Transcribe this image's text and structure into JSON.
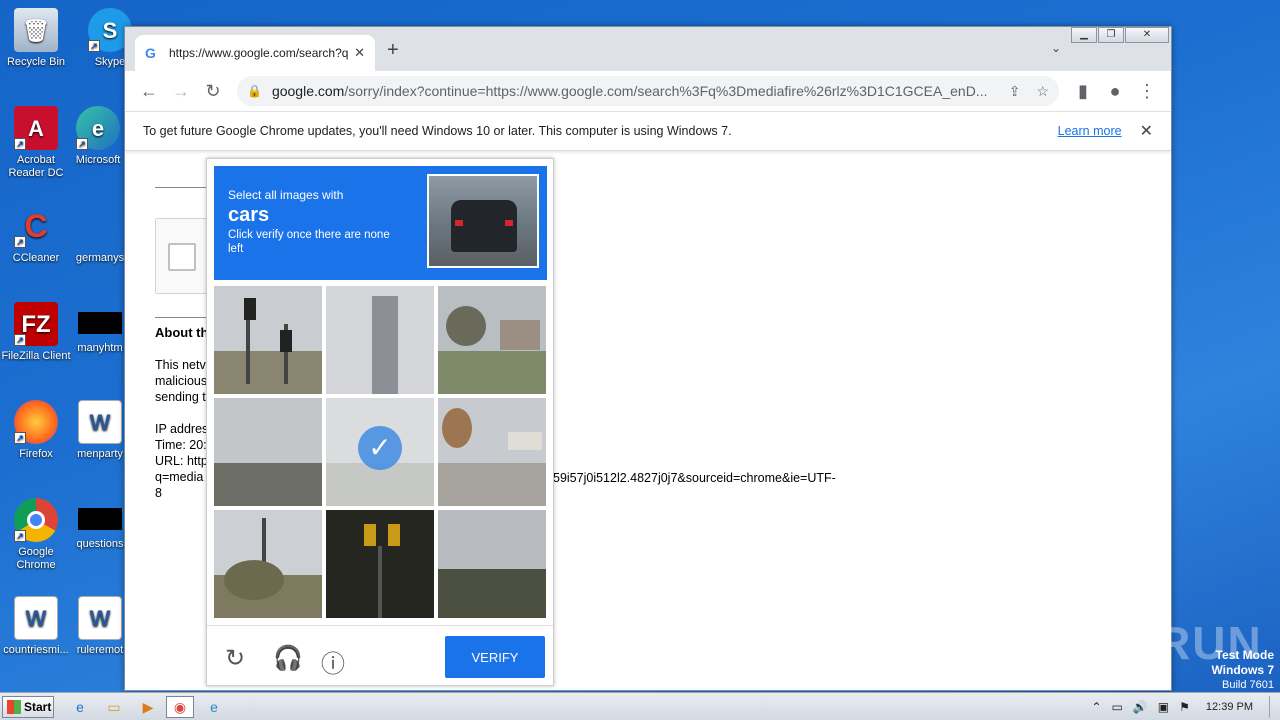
{
  "desktop": {
    "icons": [
      {
        "label": "Recycle Bin"
      },
      {
        "label": "Skype"
      },
      {
        "label": "Acrobat Reader DC"
      },
      {
        "label": "Microsoft"
      },
      {
        "label": "CCleaner"
      },
      {
        "label": "germanys"
      },
      {
        "label": "FileZilla Client"
      },
      {
        "label": "manyhtm"
      },
      {
        "label": "Firefox"
      },
      {
        "label": "menparty"
      },
      {
        "label": "Google Chrome"
      },
      {
        "label": "questions"
      },
      {
        "label": "countriesmi..."
      },
      {
        "label": "ruleremot"
      }
    ]
  },
  "browser": {
    "tab_title": "https://www.google.com/search?q=",
    "url_host": "google.com",
    "url_path": "/sorry/index?continue=https://www.google.com/search%3Fq%3Dmediafire%26rlz%3D1C1GCEA_enD...",
    "infobar_text": "To get future Google Chrome updates, you'll need Windows 10 or later. This computer is using Windows 7.",
    "infobar_link": "Learn more"
  },
  "page": {
    "about_title": "About th",
    "about_text": "This netv\nmalicious\nsending t\n\nIP addres\nTime: 20:\nURL: http\nq=media\n8",
    "url_tail": "59i57j0i512l2.4827j0j7&sourceid=chrome&ie=UTF-"
  },
  "captcha": {
    "prompt_small": "Select all images with",
    "prompt_big": "cars",
    "prompt_sub": "Click verify once there are none left",
    "verify_label": "VERIFY"
  },
  "watermark": "ANY RUN",
  "testmode": {
    "line1": "Test Mode",
    "line2": "Windows 7",
    "line3": "Build 7601"
  },
  "taskbar": {
    "start_label": "Start",
    "clock": "12:39 PM"
  }
}
